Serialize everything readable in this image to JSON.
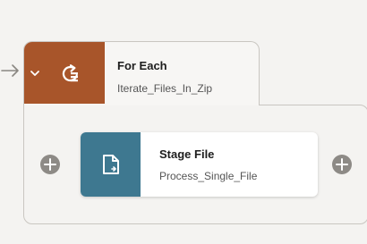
{
  "foreach": {
    "title": "For Each",
    "subtitle": "Iterate_Files_In_Zip",
    "accent_color": "#a8552a",
    "icon": "loop-icon",
    "expand_icon": "chevron-down-icon"
  },
  "stage": {
    "title": "Stage File",
    "subtitle": "Process_Single_File",
    "accent_color": "#3e7890",
    "icon": "file-icon"
  },
  "add_buttons": [
    {
      "icon": "plus-icon"
    },
    {
      "icon": "plus-icon"
    }
  ],
  "connector": {
    "icon": "arrow-right-icon"
  }
}
